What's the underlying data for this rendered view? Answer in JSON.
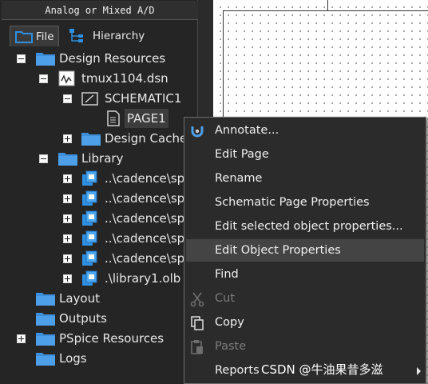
{
  "panel": {
    "title": "Analog or Mixed A/D",
    "tabs": [
      {
        "label": "File",
        "icon": "folder-icon",
        "active": true
      },
      {
        "label": "Hierarchy",
        "icon": "hierarchy-icon",
        "active": false
      }
    ]
  },
  "tree": {
    "items": [
      {
        "label": "Design Resources",
        "icon": "folder-icon",
        "expander": "minus"
      },
      {
        "label": "tmux1104.dsn",
        "icon": "design-file-icon",
        "expander": "minus"
      },
      {
        "label": "SCHEMATIC1",
        "icon": "schematic-folder-icon",
        "expander": "minus"
      },
      {
        "label": "PAGE1",
        "icon": "page-icon",
        "expander": "none",
        "selected": true
      },
      {
        "label": "Design Cache",
        "icon": "folder-icon",
        "expander": "plus"
      },
      {
        "label": "Library",
        "icon": "folder-icon",
        "expander": "minus"
      },
      {
        "label": "..\\cadence\\sp",
        "icon": "library-icon",
        "expander": "plus"
      },
      {
        "label": "..\\cadence\\sp",
        "icon": "library-icon",
        "expander": "plus"
      },
      {
        "label": "..\\cadence\\sp",
        "icon": "library-icon",
        "expander": "plus"
      },
      {
        "label": "..\\cadence\\sp",
        "icon": "library-icon",
        "expander": "plus"
      },
      {
        "label": "..\\cadence\\sp",
        "icon": "library-icon",
        "expander": "plus"
      },
      {
        "label": ".\\library1.olb",
        "icon": "library-icon",
        "expander": "plus"
      },
      {
        "label": "Layout",
        "icon": "folder-icon",
        "expander": "none"
      },
      {
        "label": "Outputs",
        "icon": "folder-icon",
        "expander": "none"
      },
      {
        "label": "PSpice Resources",
        "icon": "folder-icon",
        "expander": "plus"
      },
      {
        "label": "Logs",
        "icon": "folder-icon",
        "expander": "none"
      }
    ]
  },
  "context_menu": {
    "items": [
      {
        "label": "Annotate...",
        "icon": "annotate-icon"
      },
      {
        "label": "Edit Page"
      },
      {
        "label": "Rename"
      },
      {
        "label": "Schematic Page Properties"
      },
      {
        "label": "Edit selected object properties..."
      },
      {
        "label": "Edit Object Properties",
        "highlighted": true
      },
      {
        "label": "Find"
      },
      {
        "label": "Cut",
        "icon": "scissors-icon",
        "disabled": true
      },
      {
        "label": "Copy",
        "icon": "copy-icon"
      },
      {
        "label": "Paste",
        "icon": "paste-icon",
        "disabled": true
      },
      {
        "label": "Reports",
        "submenu": true
      }
    ]
  },
  "watermark": "CSDN @牛油果昔多滋",
  "colors": {
    "accent_blue": "#2f8fe0",
    "folder_blue": "#3d8edb",
    "highlight": "#444444"
  }
}
